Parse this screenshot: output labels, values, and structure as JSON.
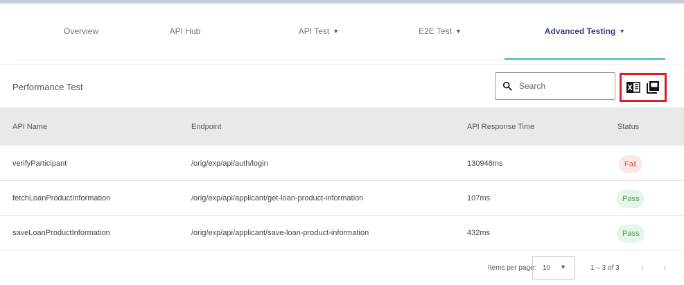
{
  "nav": {
    "tabs": [
      {
        "label": "Overview",
        "caret": ""
      },
      {
        "label": "API Hub",
        "caret": ""
      },
      {
        "label": "API Test",
        "caret": "▼"
      },
      {
        "label": "E2E Test",
        "caret": "▼"
      },
      {
        "label": "Advanced Testing",
        "caret": "▼"
      }
    ],
    "active_tab": "Advanced Testing"
  },
  "card": {
    "title": "Performance Test",
    "search_placeholder": "Search",
    "export_icons": [
      "excel-export-icon",
      "pdf-export-icon"
    ]
  },
  "table": {
    "headers": [
      "API Name",
      "Endpoint",
      "API Response Time",
      "Status"
    ],
    "rows": [
      {
        "api_name": "verifyParticipant",
        "endpoint": "/orig/exp/api/auth/login",
        "response_time": "130948ms",
        "status": "Fail"
      },
      {
        "api_name": "fetchLoanProductInformation",
        "endpoint": "/orig/exp/api/applicant/get-loan-product-information",
        "response_time": "107ms",
        "status": "Pass"
      },
      {
        "api_name": "saveLoanProductInformation",
        "endpoint": "/orig/exp/api/applicant/save-loan-product-information",
        "response_time": "432ms",
        "status": "Pass"
      }
    ]
  },
  "pager": {
    "items_per_page_label": "Items per page:",
    "items_per_page_value": "10",
    "range": "1 – 3 of 3",
    "prev": "‹",
    "next": "›"
  },
  "colors": {
    "accent": "#4ab2b0",
    "active_tab_text": "#3a3f8a",
    "highlight_border": "#e01b24",
    "fail": "#d9534f",
    "pass": "#4e9a5e"
  }
}
